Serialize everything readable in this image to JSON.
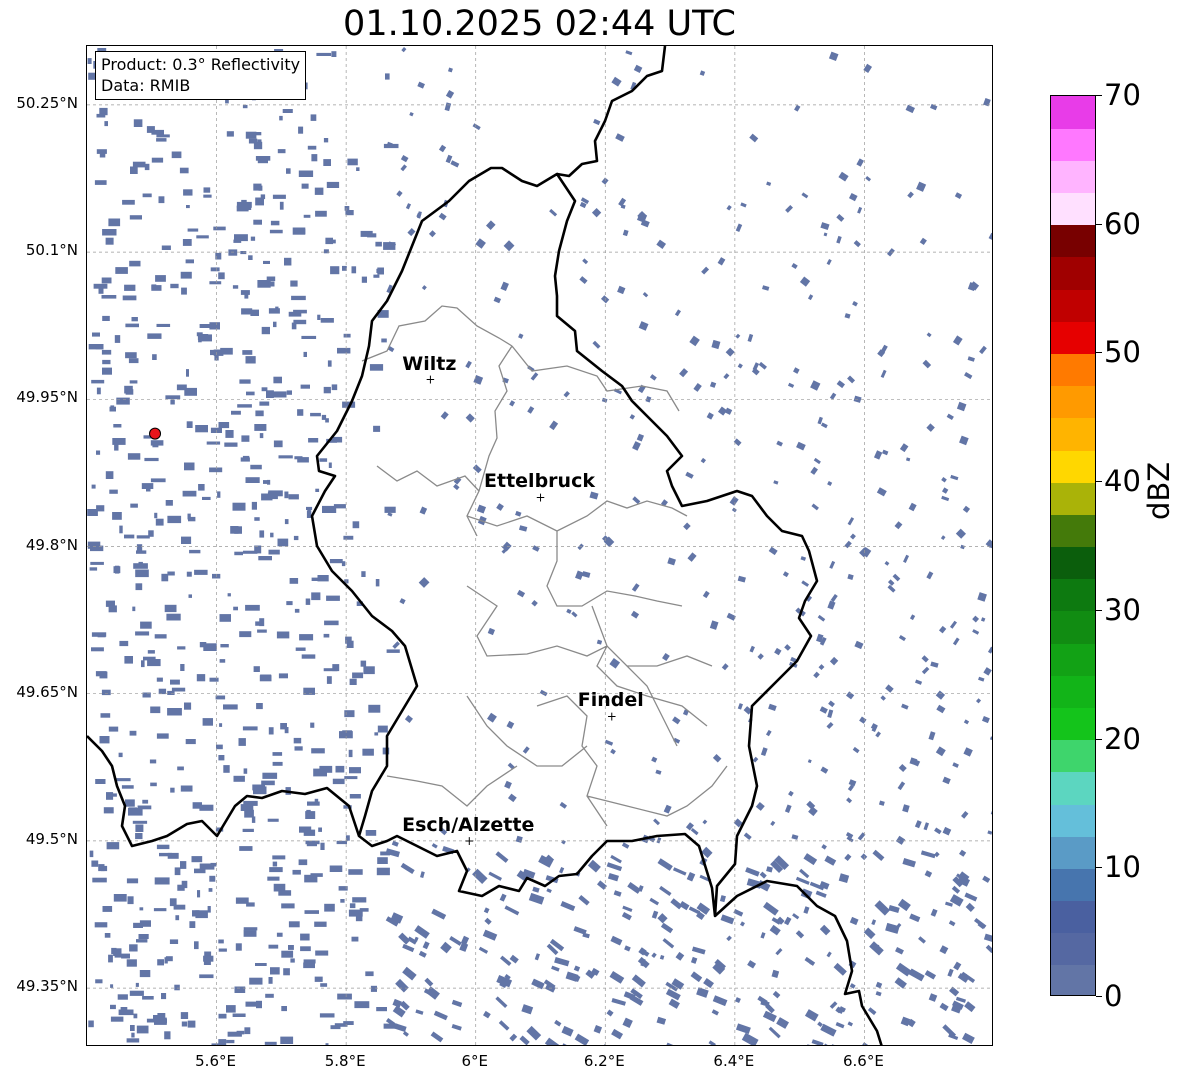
{
  "title": "01.10.2025 02:44 UTC",
  "info": {
    "product": "Product: 0.3° Reflectivity",
    "data_source": "Data: RMIB"
  },
  "map_extent": {
    "lon_min": 5.4,
    "lon_max": 6.8,
    "lat_min": 49.29,
    "lat_max": 50.31
  },
  "lat_ticks": [
    {
      "value": 50.25,
      "label": "50.25°N"
    },
    {
      "value": 50.1,
      "label": "50.1°N"
    },
    {
      "value": 49.95,
      "label": "49.95°N"
    },
    {
      "value": 49.8,
      "label": "49.8°N"
    },
    {
      "value": 49.65,
      "label": "49.65°N"
    },
    {
      "value": 49.5,
      "label": "49.5°N"
    },
    {
      "value": 49.35,
      "label": "49.35°N"
    }
  ],
  "lon_ticks": [
    {
      "value": 5.6,
      "label": "5.6°E"
    },
    {
      "value": 5.8,
      "label": "5.8°E"
    },
    {
      "value": 6.0,
      "label": "6°E"
    },
    {
      "value": 6.2,
      "label": "6.2°E"
    },
    {
      "value": 6.4,
      "label": "6.4°E"
    },
    {
      "value": 6.6,
      "label": "6.6°E"
    }
  ],
  "cities": [
    {
      "name": "Wiltz",
      "lon": 5.93,
      "lat": 49.97
    },
    {
      "name": "Ettelbruck",
      "lon": 6.1,
      "lat": 49.85
    },
    {
      "name": "Findel",
      "lon": 6.21,
      "lat": 49.627
    },
    {
      "name": "Esch/Alzette",
      "lon": 5.99,
      "lat": 49.5
    }
  ],
  "radar_site": {
    "lon": 5.505,
    "lat": 49.915,
    "color": "#e8151b"
  },
  "echo_color": "#6275a6",
  "colorbar": {
    "unit": "dBZ",
    "min": 0,
    "max": 70,
    "ticks": [
      "0",
      "10",
      "20",
      "30",
      "40",
      "50",
      "60",
      "70"
    ],
    "colors": [
      "#6275a6",
      "#5568a2",
      "#4a60a0",
      "#4775ae",
      "#5a9bc6",
      "#64bfda",
      "#5cd6c0",
      "#3ed56c",
      "#14c41b",
      "#12b418",
      "#12a215",
      "#118c12",
      "#0d7a10",
      "#0b5e0c",
      "#447a0a",
      "#aab308",
      "#ffd700",
      "#ffb400",
      "#ff9a00",
      "#ff7a00",
      "#e60000",
      "#c00000",
      "#a00000",
      "#780000",
      "#ffe0ff",
      "#ffb4ff",
      "#ff78ff",
      "#e83ce8"
    ]
  }
}
